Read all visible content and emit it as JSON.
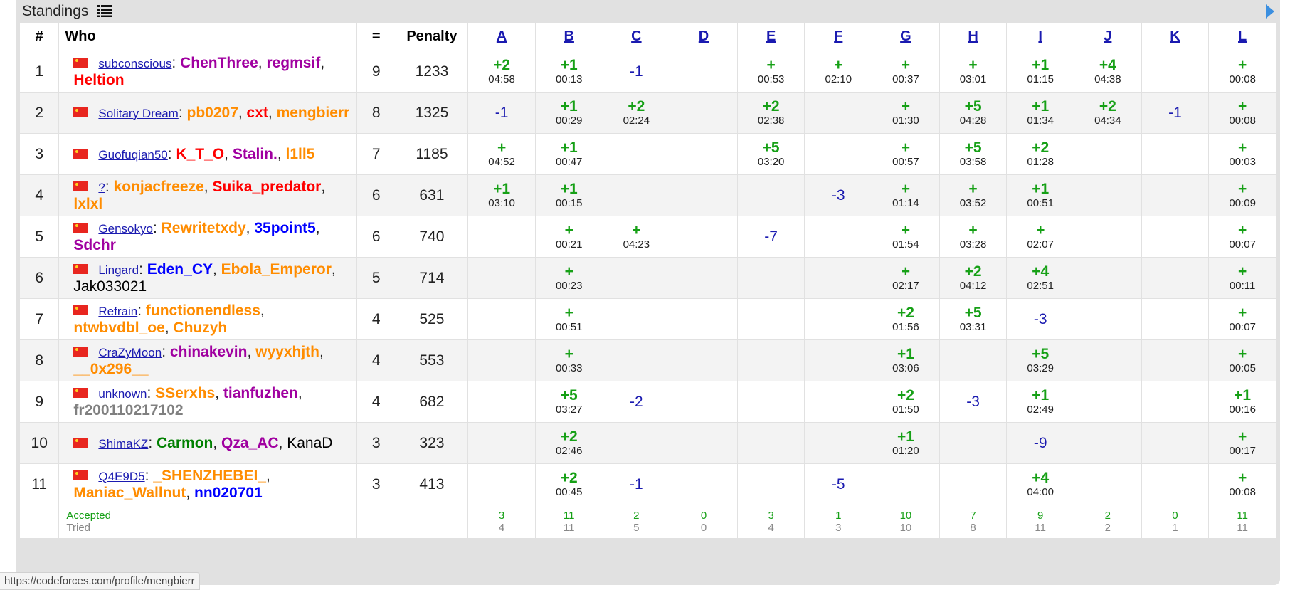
{
  "title": "Standings",
  "status_url": "https://codeforces.com/profile/mengbierr",
  "colors": {
    "accepted": "#16a016",
    "rejected": "#1a1ab0",
    "link": "#1a1ab0",
    "row_alt": "#f3f3f3"
  },
  "headers": {
    "rank": "#",
    "who": "Who",
    "solved": "=",
    "penalty": "Penalty"
  },
  "problems": [
    "A",
    "B",
    "C",
    "D",
    "E",
    "F",
    "G",
    "H",
    "I",
    "J",
    "K",
    "L"
  ],
  "rows": [
    {
      "rank": "1",
      "team": "subconscious",
      "members": [
        {
          "name": "ChenThree",
          "color": "purple"
        },
        {
          "name": "regmsif",
          "color": "purple"
        },
        {
          "name": "Heltion",
          "color": "red"
        }
      ],
      "solved": "9",
      "penalty": "1233",
      "cells": [
        [
          "+2",
          "04:58"
        ],
        [
          "+1",
          "00:13"
        ],
        [
          "-1",
          ""
        ],
        [
          "",
          ""
        ],
        [
          "+",
          "00:53"
        ],
        [
          "+",
          "02:10"
        ],
        [
          "+",
          "00:37"
        ],
        [
          "+",
          "03:01"
        ],
        [
          "+1",
          "01:15"
        ],
        [
          "+4",
          "04:38"
        ],
        [
          "",
          ""
        ],
        [
          "+",
          "00:08"
        ]
      ]
    },
    {
      "rank": "2",
      "team": "Solitary Dream",
      "members": [
        {
          "name": "pb0207",
          "color": "orange"
        },
        {
          "name": "cxt",
          "color": "red"
        },
        {
          "name": "mengbierr",
          "color": "orange"
        }
      ],
      "solved": "8",
      "penalty": "1325",
      "cells": [
        [
          "-1",
          ""
        ],
        [
          "+1",
          "00:29"
        ],
        [
          "+2",
          "02:24"
        ],
        [
          "",
          ""
        ],
        [
          "+2",
          "02:38"
        ],
        [
          "",
          ""
        ],
        [
          "+",
          "01:30"
        ],
        [
          "+5",
          "04:28"
        ],
        [
          "+1",
          "01:34"
        ],
        [
          "+2",
          "04:34"
        ],
        [
          "-1",
          ""
        ],
        [
          "+",
          "00:08"
        ]
      ]
    },
    {
      "rank": "3",
      "team": "Guofuqian50",
      "members": [
        {
          "name": "K_T_O",
          "color": "red"
        },
        {
          "name": "Stalin.",
          "color": "purple"
        },
        {
          "name": "l1ll5",
          "color": "orange"
        }
      ],
      "solved": "7",
      "penalty": "1185",
      "cells": [
        [
          "+",
          "04:52"
        ],
        [
          "+1",
          "00:47"
        ],
        [
          "",
          ""
        ],
        [
          "",
          ""
        ],
        [
          "+5",
          "03:20"
        ],
        [
          "",
          ""
        ],
        [
          "+",
          "00:57"
        ],
        [
          "+5",
          "03:58"
        ],
        [
          "+2",
          "01:28"
        ],
        [
          "",
          ""
        ],
        [
          "",
          ""
        ],
        [
          "+",
          "00:03"
        ]
      ]
    },
    {
      "rank": "4",
      "team": "?",
      "members": [
        {
          "name": "konjacfreeze",
          "color": "orange"
        },
        {
          "name": "Suika_predator",
          "color": "red"
        },
        {
          "name": "lxlxl",
          "color": "orange"
        }
      ],
      "solved": "6",
      "penalty": "631",
      "cells": [
        [
          "+1",
          "03:10"
        ],
        [
          "+1",
          "00:15"
        ],
        [
          "",
          ""
        ],
        [
          "",
          ""
        ],
        [
          "",
          ""
        ],
        [
          "-3",
          ""
        ],
        [
          "+",
          "01:14"
        ],
        [
          "+",
          "03:52"
        ],
        [
          "+1",
          "00:51"
        ],
        [
          "",
          ""
        ],
        [
          "",
          ""
        ],
        [
          "+",
          "00:09"
        ]
      ]
    },
    {
      "rank": "5",
      "team": "Gensokyo",
      "members": [
        {
          "name": "Rewritetxdy",
          "color": "orange"
        },
        {
          "name": "35point5",
          "color": "blue"
        },
        {
          "name": "Sdchr",
          "color": "purple"
        }
      ],
      "solved": "6",
      "penalty": "740",
      "cells": [
        [
          "",
          ""
        ],
        [
          "+",
          "00:21"
        ],
        [
          "+",
          "04:23"
        ],
        [
          "",
          ""
        ],
        [
          "-7",
          ""
        ],
        [
          "",
          ""
        ],
        [
          "+",
          "01:54"
        ],
        [
          "+",
          "03:28"
        ],
        [
          "+",
          "02:07"
        ],
        [
          "",
          ""
        ],
        [
          "",
          ""
        ],
        [
          "+",
          "00:07"
        ]
      ]
    },
    {
      "rank": "6",
      "team": "Lingard",
      "members": [
        {
          "name": "Eden_CY",
          "color": "blue"
        },
        {
          "name": "Ebola_Emperor",
          "color": "orange"
        },
        {
          "name": "Jak033021",
          "color": "black"
        }
      ],
      "solved": "5",
      "penalty": "714",
      "cells": [
        [
          "",
          ""
        ],
        [
          "+",
          "00:23"
        ],
        [
          "",
          ""
        ],
        [
          "",
          ""
        ],
        [
          "",
          ""
        ],
        [
          "",
          ""
        ],
        [
          "+",
          "02:17"
        ],
        [
          "+2",
          "04:12"
        ],
        [
          "+4",
          "02:51"
        ],
        [
          "",
          ""
        ],
        [
          "",
          ""
        ],
        [
          "+",
          "00:11"
        ]
      ]
    },
    {
      "rank": "7",
      "team": "Refrain",
      "members": [
        {
          "name": "functionendless",
          "color": "orange"
        },
        {
          "name": "ntwbvdbl_oe",
          "color": "orange"
        },
        {
          "name": "Chuzyh",
          "color": "orange"
        }
      ],
      "solved": "4",
      "penalty": "525",
      "cells": [
        [
          "",
          ""
        ],
        [
          "+",
          "00:51"
        ],
        [
          "",
          ""
        ],
        [
          "",
          ""
        ],
        [
          "",
          ""
        ],
        [
          "",
          ""
        ],
        [
          "+2",
          "01:56"
        ],
        [
          "+5",
          "03:31"
        ],
        [
          "-3",
          ""
        ],
        [
          "",
          ""
        ],
        [
          "",
          ""
        ],
        [
          "+",
          "00:07"
        ]
      ]
    },
    {
      "rank": "8",
      "team": "CraZyMoon",
      "members": [
        {
          "name": "chinakevin",
          "color": "purple"
        },
        {
          "name": "wyyxhjth",
          "color": "orange"
        },
        {
          "name": "__0x296__",
          "color": "orange"
        }
      ],
      "solved": "4",
      "penalty": "553",
      "cells": [
        [
          "",
          ""
        ],
        [
          "+",
          "00:33"
        ],
        [
          "",
          ""
        ],
        [
          "",
          ""
        ],
        [
          "",
          ""
        ],
        [
          "",
          ""
        ],
        [
          "+1",
          "03:06"
        ],
        [
          "",
          ""
        ],
        [
          "+5",
          "03:29"
        ],
        [
          "",
          ""
        ],
        [
          "",
          ""
        ],
        [
          "+",
          "00:05"
        ]
      ]
    },
    {
      "rank": "9",
      "team": "unknown",
      "members": [
        {
          "name": "SSerxhs",
          "color": "orange"
        },
        {
          "name": "tianfuzhen",
          "color": "purple"
        },
        {
          "name": "fr200110217102",
          "color": "gray"
        }
      ],
      "solved": "4",
      "penalty": "682",
      "cells": [
        [
          "",
          ""
        ],
        [
          "+5",
          "03:27"
        ],
        [
          "-2",
          ""
        ],
        [
          "",
          ""
        ],
        [
          "",
          ""
        ],
        [
          "",
          ""
        ],
        [
          "+2",
          "01:50"
        ],
        [
          "-3",
          ""
        ],
        [
          "+1",
          "02:49"
        ],
        [
          "",
          ""
        ],
        [
          "",
          ""
        ],
        [
          "+1",
          "00:16"
        ]
      ]
    },
    {
      "rank": "10",
      "team": "ShimaKZ",
      "members": [
        {
          "name": "Carmon",
          "color": "green"
        },
        {
          "name": "Qza_AC",
          "color": "purple"
        },
        {
          "name": "KanaD",
          "color": "black"
        }
      ],
      "solved": "3",
      "penalty": "323",
      "cells": [
        [
          "",
          ""
        ],
        [
          "+2",
          "02:46"
        ],
        [
          "",
          ""
        ],
        [
          "",
          ""
        ],
        [
          "",
          ""
        ],
        [
          "",
          ""
        ],
        [
          "+1",
          "01:20"
        ],
        [
          "",
          ""
        ],
        [
          "-9",
          ""
        ],
        [
          "",
          ""
        ],
        [
          "",
          ""
        ],
        [
          "+",
          "00:17"
        ]
      ]
    },
    {
      "rank": "11",
      "team": "Q4E9D5",
      "members": [
        {
          "name": "_SHENZHEBEI_",
          "color": "orange"
        },
        {
          "name": "Maniac_Wallnut",
          "color": "orange"
        },
        {
          "name": "nn020701",
          "color": "blue"
        }
      ],
      "solved": "3",
      "penalty": "413",
      "cells": [
        [
          "",
          ""
        ],
        [
          "+2",
          "00:45"
        ],
        [
          "-1",
          ""
        ],
        [
          "",
          ""
        ],
        [
          "",
          ""
        ],
        [
          "-5",
          ""
        ],
        [
          "",
          ""
        ],
        [
          "",
          ""
        ],
        [
          "+4",
          "04:00"
        ],
        [
          "",
          ""
        ],
        [
          "",
          ""
        ],
        [
          "+",
          "00:08"
        ]
      ]
    }
  ],
  "footer": {
    "accepted_label": "Accepted",
    "tried_label": "Tried",
    "accepted": [
      "3",
      "11",
      "2",
      "0",
      "3",
      "1",
      "10",
      "7",
      "9",
      "2",
      "0",
      "11"
    ],
    "tried": [
      "4",
      "11",
      "5",
      "0",
      "4",
      "3",
      "10",
      "8",
      "11",
      "2",
      "1",
      "11"
    ]
  }
}
